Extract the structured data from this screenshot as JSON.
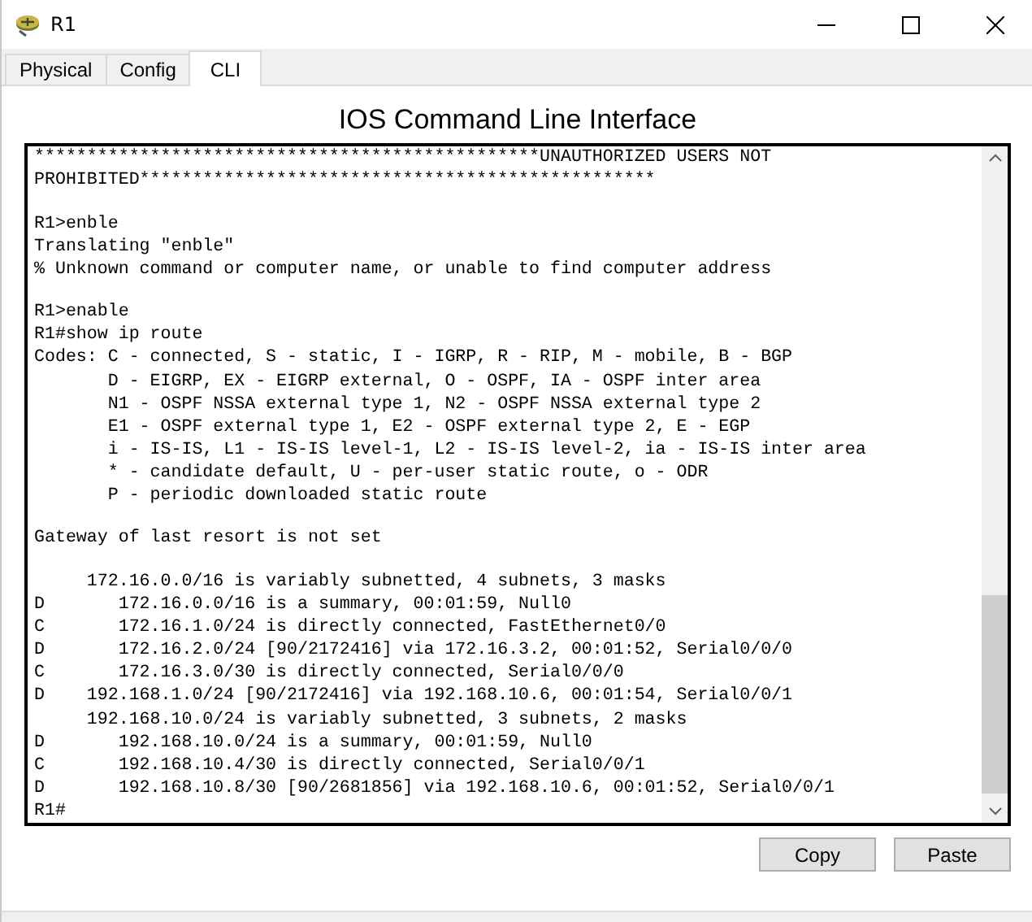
{
  "window": {
    "title": "R1"
  },
  "tabs": [
    {
      "label": "Physical",
      "selected": false
    },
    {
      "label": "Config",
      "selected": false
    },
    {
      "label": "CLI",
      "selected": true
    }
  ],
  "heading": "IOS Command Line Interface",
  "terminal": {
    "lines": [
      {
        "kind": "text",
        "text": "************************************************UNAUTHORIZED USERS NOT"
      },
      {
        "kind": "text",
        "text": "PROHIBITED*************************************************"
      },
      {
        "kind": "blank"
      },
      {
        "kind": "text",
        "text": "R1>enble"
      },
      {
        "kind": "text",
        "text": "Translating \"enble\""
      },
      {
        "kind": "text",
        "text": "% Unknown command or computer name, or unable to find computer address"
      },
      {
        "kind": "blank"
      },
      {
        "kind": "text",
        "text": "R1>enable"
      },
      {
        "kind": "text",
        "text": "R1#show ip route"
      },
      {
        "kind": "text",
        "text": "Codes: C - connected, S - static, I - IGRP, R - RIP, M - mobile, B - BGP"
      },
      {
        "kind": "text",
        "text": "       D - EIGRP, EX - EIGRP external, O - OSPF, IA - OSPF inter area"
      },
      {
        "kind": "text",
        "text": "       N1 - OSPF NSSA external type 1, N2 - OSPF NSSA external type 2"
      },
      {
        "kind": "text",
        "text": "       E1 - OSPF external type 1, E2 - OSPF external type 2, E - EGP"
      },
      {
        "kind": "text",
        "text": "       i - IS-IS, L1 - IS-IS level-1, L2 - IS-IS level-2, ia - IS-IS inter area"
      },
      {
        "kind": "text",
        "text": "       * - candidate default, U - per-user static route, o - ODR"
      },
      {
        "kind": "text",
        "text": "       P - periodic downloaded static route"
      },
      {
        "kind": "blank"
      },
      {
        "kind": "text",
        "text": "Gateway of last resort is not set"
      },
      {
        "kind": "blank"
      },
      {
        "kind": "text",
        "text": "     172.16.0.0/16 is variably subnetted, 4 subnets, 3 masks"
      },
      {
        "kind": "text",
        "text": "D       172.16.0.0/16 is a summary, 00:01:59, Null0"
      },
      {
        "kind": "text",
        "text": "C       172.16.1.0/24 is directly connected, FastEthernet0/0"
      },
      {
        "kind": "text",
        "text": "D       172.16.2.0/24 [90/2172416] via 172.16.3.2, 00:01:52, Serial0/0/0"
      },
      {
        "kind": "text",
        "text": "C       172.16.3.0/30 is directly connected, Serial0/0/0"
      },
      {
        "kind": "text",
        "text": "D    192.168.1.0/24 [90/2172416] via 192.168.10.6, 00:01:54, Serial0/0/1"
      },
      {
        "kind": "text",
        "text": "     192.168.10.0/24 is variably subnetted, 3 subnets, 2 masks"
      },
      {
        "kind": "text",
        "text": "D       192.168.10.0/24 is a summary, 00:01:59, Null0"
      },
      {
        "kind": "text",
        "text": "C       192.168.10.4/30 is directly connected, Serial0/0/1"
      },
      {
        "kind": "text",
        "text": "D       192.168.10.8/30 [90/2681856] via 192.168.10.6, 00:01:52, Serial0/0/1"
      },
      {
        "kind": "text",
        "text": "R1#"
      }
    ]
  },
  "buttons": [
    "Copy",
    "Paste"
  ]
}
